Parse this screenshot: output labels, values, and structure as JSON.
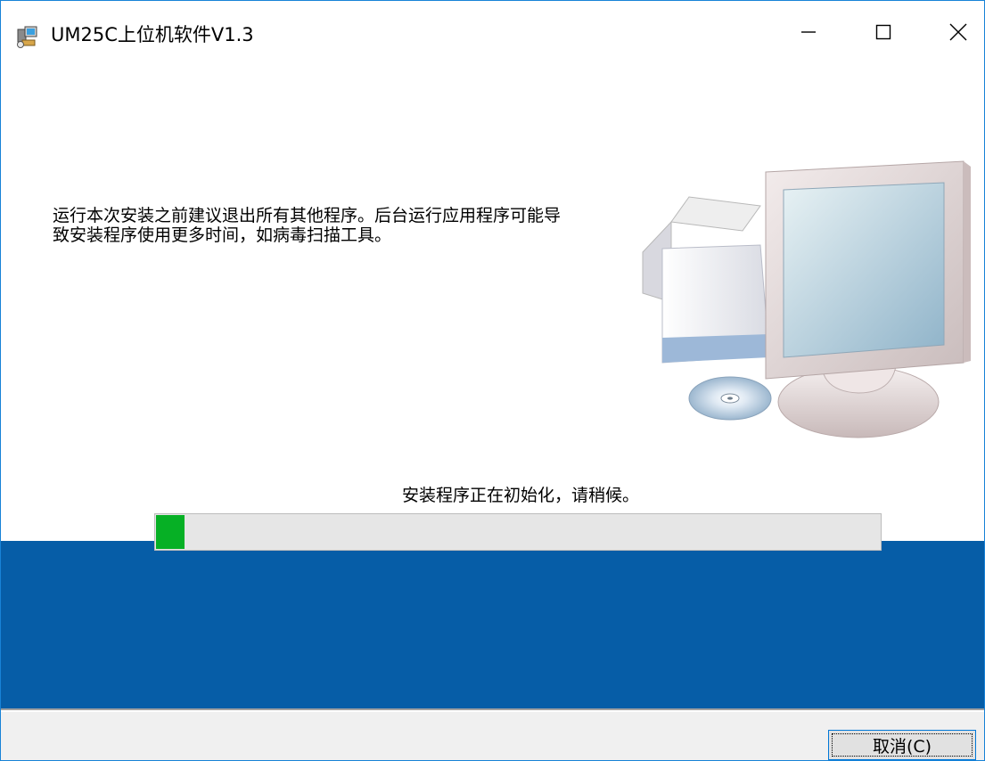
{
  "window": {
    "title": "UM25C上位机软件V1.3",
    "icon": "installer-icon",
    "controls": {
      "minimize_icon": "minimize-icon",
      "maximize_icon": "maximize-icon",
      "close_icon": "close-icon"
    }
  },
  "main": {
    "message_line1": "运行本次安装之前建议退出所有其他程序。后台运行应用程序可能导",
    "message_line2": "致安装程序使用更多时间，如病毒扫描工具。",
    "illustration": "computer-and-box-illustration",
    "status": "安装程序正在初始化，请稍候。",
    "progress_fraction": 0.04
  },
  "footer": {
    "cancel_label": "取消(C)"
  },
  "colors": {
    "window_border": "#1883d7",
    "band": "#065da7",
    "progress": "#06b025",
    "progress_track": "#e6e6e6",
    "footer_bg": "#f0f0f0"
  }
}
